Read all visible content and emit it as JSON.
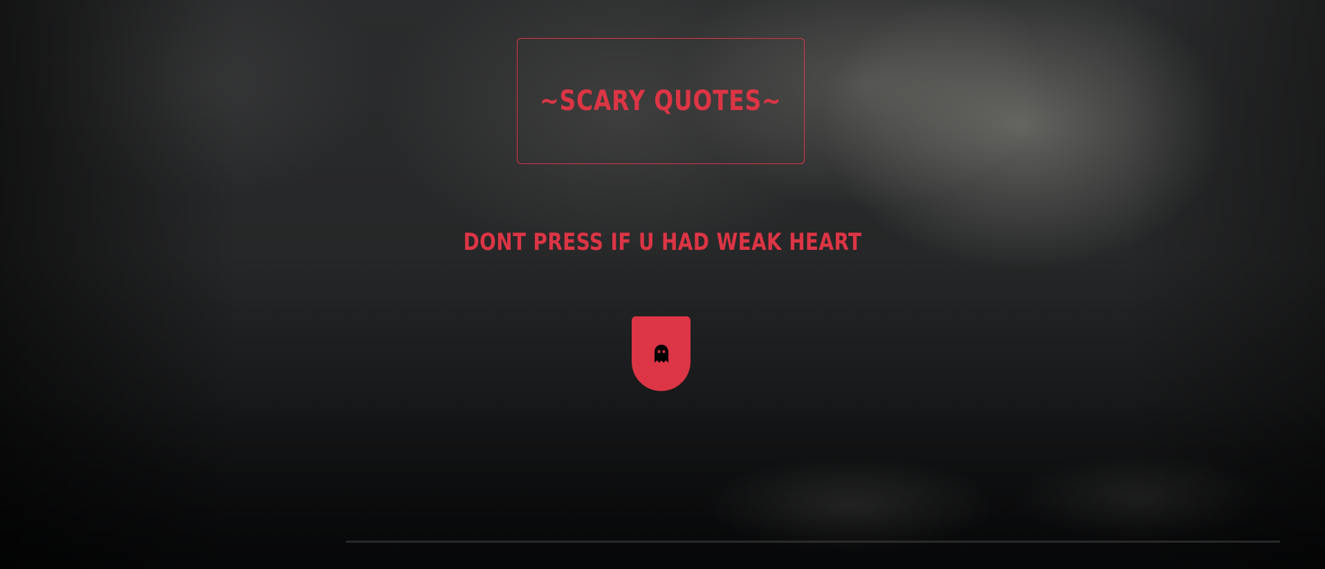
{
  "header": {
    "title": "~SCARY QUOTES~"
  },
  "main": {
    "warning": "DONT PRESS IF U HAD WEAK HEART",
    "button": {
      "icon": "ghost-icon"
    }
  },
  "colors": {
    "accent": "#dc3545",
    "icon": "#000000"
  }
}
